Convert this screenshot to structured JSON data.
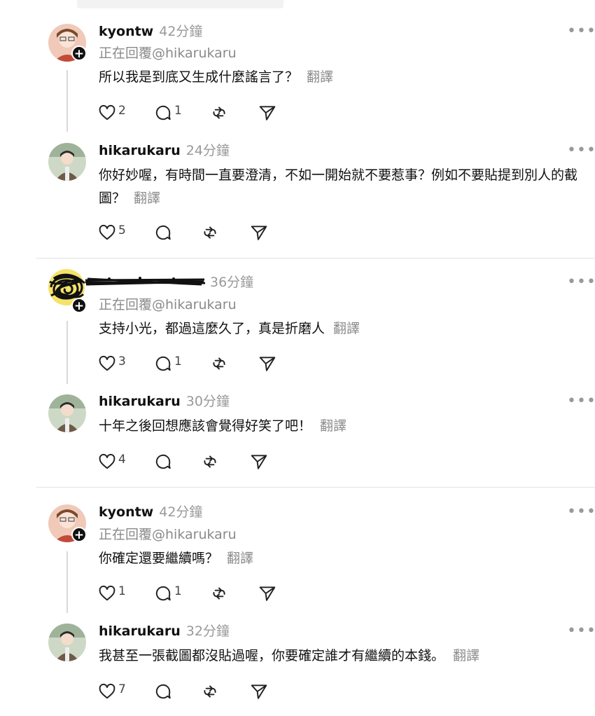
{
  "posts": [
    {
      "user": "kyontw",
      "time": "42分鐘",
      "replying": "正在回覆@hikarukaru",
      "text": "所以我是到底又生成什麼謠言了？",
      "translate": "翻譯",
      "likes": "2",
      "replies": "1"
    },
    {
      "user": "hikarukaru",
      "time": "24分鐘",
      "text": "你好妙喔，有時間一直要澄清，不如一開始就不要惹事？例如不要貼提到別人的截圖？",
      "translate": "翻譯",
      "likes": "5"
    },
    {
      "user": "",
      "time": "36分鐘",
      "replying": "正在回覆@hikarukaru",
      "text": "支持小光，都過這麼久了，真是折磨人",
      "translate": "翻譯",
      "likes": "3",
      "replies": "1"
    },
    {
      "user": "hikarukaru",
      "time": "30分鐘",
      "text": "十年之後回想應該會覺得好笑了吧！",
      "translate": "翻譯",
      "likes": "4"
    },
    {
      "user": "kyontw",
      "time": "42分鐘",
      "replying": "正在回覆@hikarukaru",
      "text": "你確定還要繼續嗎？",
      "translate": "翻譯",
      "likes": "1",
      "replies": "1"
    },
    {
      "user": "hikarukaru",
      "time": "32分鐘",
      "text": "我甚至一張截圖都沒貼過喔，你要確定誰才有繼續的本錢。",
      "translate": "翻譯",
      "likes": "7"
    }
  ],
  "icons": {
    "like": "heart-icon",
    "reply": "comment-icon",
    "repost": "repost-icon",
    "share": "send-icon",
    "more": "more-icon"
  },
  "colors": {
    "text": "#111111",
    "muted": "#8a8a8a",
    "divider": "#e4e4e4"
  }
}
